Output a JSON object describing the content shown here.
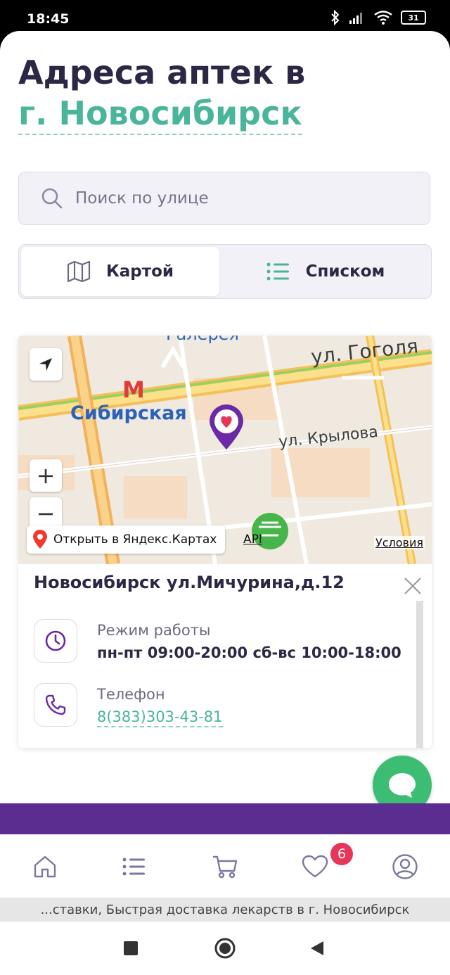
{
  "status_bar": {
    "time": "18:45",
    "battery": "31"
  },
  "page": {
    "title_line1": "Адреса аптек в",
    "city": "г. Новосибирск"
  },
  "search": {
    "placeholder": "Поиск по улице",
    "icon": "search-icon"
  },
  "view_toggle": {
    "map_label": "Картой",
    "list_label": "Списком",
    "active": "map"
  },
  "map": {
    "labels": {
      "street_gogolya": "ул. Гоголя",
      "street_krylova": "ул. Крылова",
      "metro_sibirskaya": "Сибирская",
      "galereya": "Галерея"
    },
    "open_in_yandex": "Открыть в Яндекс.Картах",
    "api": "API",
    "terms": "Условия",
    "zoom_in": "+",
    "zoom_out": "−"
  },
  "pharmacy": {
    "name": "Новосибирск ул.Мичурина,д.12",
    "hours_label": "Режим работы",
    "hours_value": "пн-пт 09:00-20:00 сб-вс 10:00-18:00",
    "phone_label": "Телефон",
    "phone_value": "8(383)303-43-81"
  },
  "bottom_nav": {
    "items": [
      "home-icon",
      "catalog-list-icon",
      "cart-icon",
      "favorites-heart-icon",
      "profile-icon"
    ],
    "favorites_count": "6"
  },
  "marquee": {
    "text": "...ставки, Быстрая доставка лекарств в г. Новосибирск"
  },
  "colors": {
    "accent_green": "#4ab59b",
    "brand_purple": "#5b2d91",
    "chat_green": "#3dbd73",
    "badge_red": "#e8355a",
    "title_dark": "#2b2745"
  }
}
